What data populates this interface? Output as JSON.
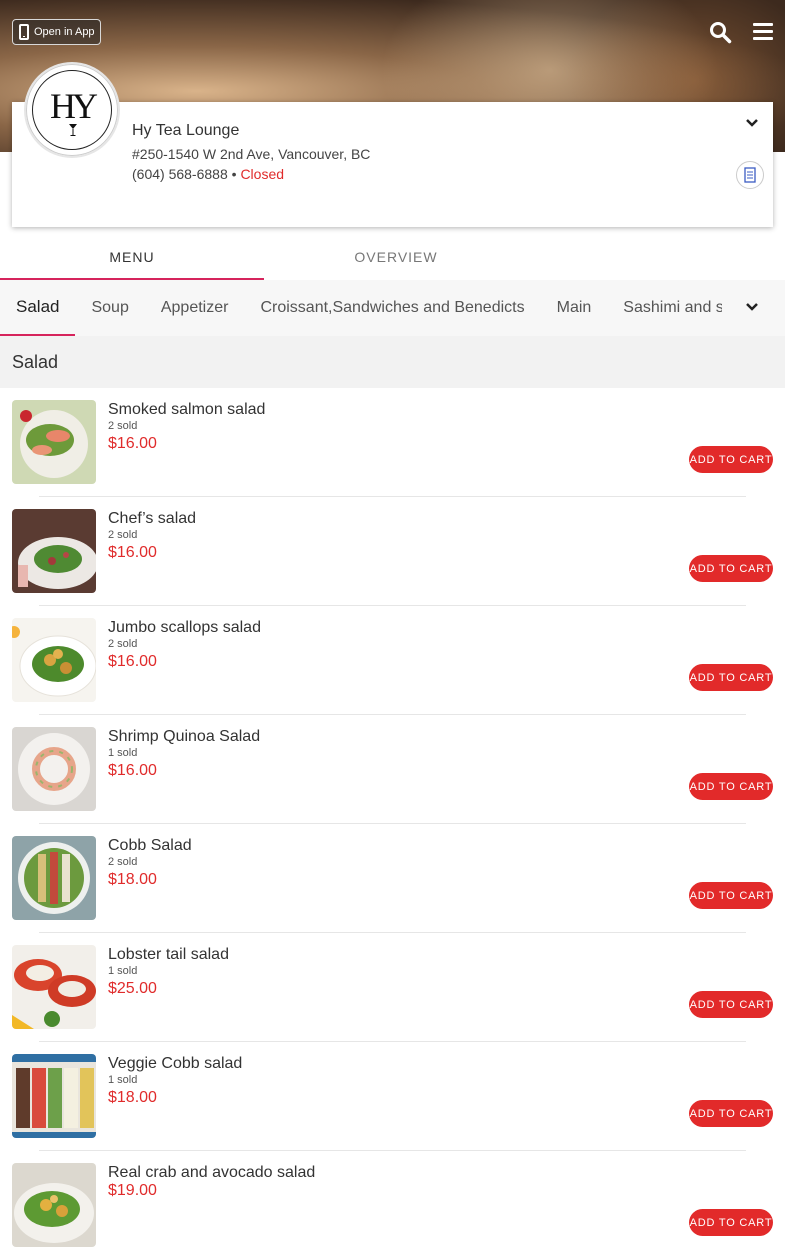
{
  "header": {
    "open_in_app_label": "Open in App"
  },
  "store": {
    "logo_mark": "HY",
    "name": "Hy Tea Lounge",
    "address": "#250-1540 W 2nd Ave, Vancouver, BC",
    "phone": "(604) 568-6888",
    "separator": "•",
    "status": "Closed"
  },
  "tabs": [
    {
      "label": "MENU",
      "active": true
    },
    {
      "label": "OVERVIEW",
      "active": false
    }
  ],
  "categories": [
    {
      "label": "Salad",
      "active": true
    },
    {
      "label": "Soup"
    },
    {
      "label": "Appetizer"
    },
    {
      "label": "Croissant,Sandwiches and Benedicts"
    },
    {
      "label": "Main"
    },
    {
      "label": "Sashimi and sushi"
    }
  ],
  "section": {
    "title": "Salad"
  },
  "items": [
    {
      "name": "Smoked salmon salad",
      "sold": "2 sold",
      "price": "$16.00",
      "button": "ADD TO CART"
    },
    {
      "name": "Chef’s salad",
      "sold": "2 sold",
      "price": "$16.00",
      "button": "ADD TO CART"
    },
    {
      "name": "Jumbo scallops salad",
      "sold": "2 sold",
      "price": "$16.00",
      "button": "ADD TO CART"
    },
    {
      "name": "Shrimp Quinoa Salad",
      "sold": "1 sold",
      "price": "$16.00",
      "button": "ADD TO CART"
    },
    {
      "name": "Cobb Salad",
      "sold": "2 sold",
      "price": "$18.00",
      "button": "ADD TO CART"
    },
    {
      "name": "Lobster tail salad",
      "sold": "1 sold",
      "price": "$25.00",
      "button": "ADD TO CART"
    },
    {
      "name": "Veggie Cobb salad",
      "sold": "1 sold",
      "price": "$18.00",
      "button": "ADD TO CART"
    },
    {
      "name": "Real crab and avocado salad",
      "sold": "",
      "price": "$19.00",
      "button": "ADD TO CART"
    }
  ],
  "colors": {
    "accent_red": "#e22a2a",
    "tab_underline": "#d6245c",
    "status_closed": "#e02b2b"
  },
  "icons": [
    "phone-icon",
    "search-icon",
    "hamburger-menu-icon",
    "chevron-down-icon",
    "document-icon"
  ]
}
